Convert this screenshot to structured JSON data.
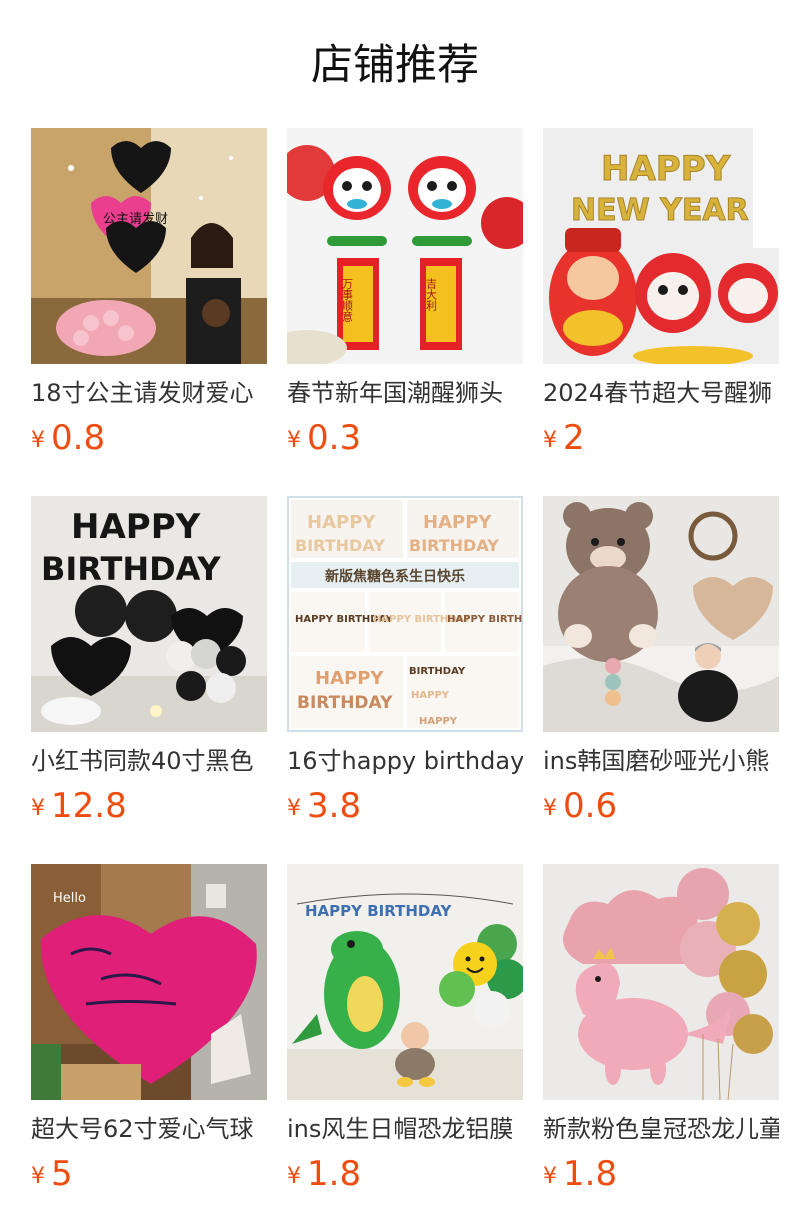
{
  "section": {
    "title": "店铺推荐"
  },
  "currency_symbol": "¥",
  "accent_color": "#ee4d12",
  "products": [
    {
      "name": "18寸公主请发财爱心",
      "price": "0.8",
      "image": "balloon-heart-photo"
    },
    {
      "name": "春节新年国潮醒狮头",
      "price": "0.3",
      "image": "lion-dance-balloon-photo"
    },
    {
      "name": "2024春节超大号醒狮",
      "price": "2",
      "image": "happy-new-year-balloon-photo"
    },
    {
      "name": "小红书同款40寸黑色",
      "price": "12.8",
      "image": "black-birthday-balloon-photo"
    },
    {
      "name": "16寸happy birthday",
      "price": "3.8",
      "image": "birthday-letter-balloon-photo"
    },
    {
      "name": "ins韩国磨砂哑光小熊",
      "price": "0.6",
      "image": "bear-balloon-photo"
    },
    {
      "name": "超大号62寸爱心气球",
      "price": "5",
      "image": "giant-heart-balloon-photo"
    },
    {
      "name": "ins风生日帽恐龙铝膜",
      "price": "1.8",
      "image": "dinosaur-balloon-photo"
    },
    {
      "name": "新款粉色皇冠恐龙儿童",
      "price": "1.8",
      "image": "pink-dinosaur-balloon-photo"
    }
  ],
  "image_texts": {
    "p1_heart": "公主请发财",
    "p2_scroll_left": "万事顺意",
    "p2_scroll_right": "吉大利",
    "p3_line1": "HAPPY",
    "p3_line2": "NEW YEAR",
    "p4_line1": "HAPPY",
    "p4_line2": "BIRTHDAY",
    "p5_banner": "新版焦糖色系生日快乐",
    "p5_small": "HAPPY BIRTHDAY",
    "p7_sign": "Hello",
    "p8_banner": "HAPPY BIRTHDAY"
  }
}
